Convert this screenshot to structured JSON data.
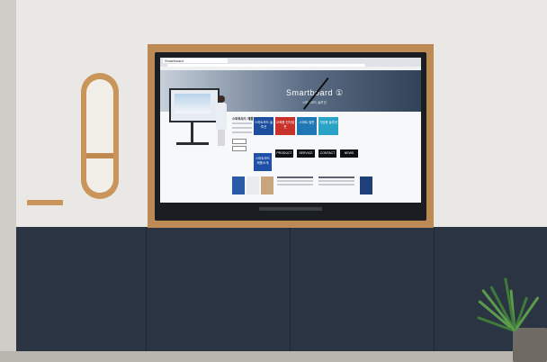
{
  "browser": {
    "tab_title": "Smartboard"
  },
  "hero": {
    "brand": "Smartboard ①",
    "subtitle": "스마트보드 솔루션"
  },
  "info": {
    "title": "스마트보드 제품소개"
  },
  "tiles": [
    {
      "label": "스마트보드 솔루션",
      "color": "#1e4e9e"
    },
    {
      "label": "교육용 전자칠판",
      "color": "#c8322b"
    },
    {
      "label": "스마트 칠판",
      "color": "#1f77b4"
    },
    {
      "label": "기업용 솔루션",
      "color": "#2aa3c7"
    }
  ],
  "dark_tiles": [
    {
      "label": "PRODUCT"
    },
    {
      "label": "SERVICE"
    },
    {
      "label": "CONTACT"
    },
    {
      "label": "NEWS"
    }
  ],
  "bottom_tile": {
    "label": "스마트보드 제품소개"
  },
  "colors": {
    "wood": "#bd8a56",
    "wall_lower": "#2b3442",
    "wall_upper": "#e9e8e4",
    "hero_dark": "#324257"
  }
}
